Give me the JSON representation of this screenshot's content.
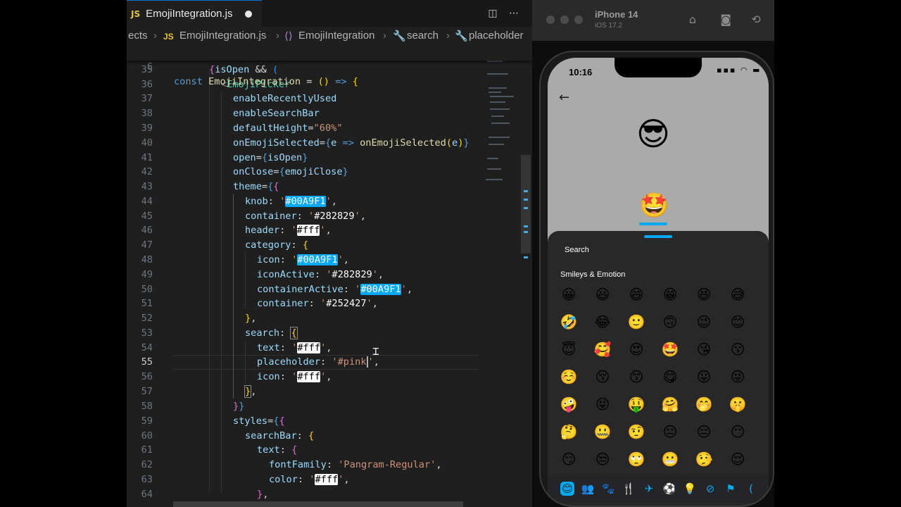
{
  "editor": {
    "tab": {
      "badge": "JS",
      "title": "EmojiIntegration.js"
    },
    "breadcrumb": {
      "part1": "ects",
      "badge": "JS",
      "file": "EmojiIntegration.js",
      "sym1": "EmojiIntegration",
      "sym2": "search",
      "sym3": "placeholder"
    },
    "current_line": 55,
    "lines": [
      {
        "n": 6,
        "text": "const EmojiIntegration = () => {"
      },
      {
        "n": 35,
        "text": "{isOpen && ("
      },
      {
        "n": 36,
        "text": "<EmojiPicker"
      },
      {
        "n": 37,
        "text": "enableRecentlyUsed"
      },
      {
        "n": 38,
        "text": "enableSearchBar"
      },
      {
        "n": 39,
        "text": "defaultHeight=\"60%\""
      },
      {
        "n": 40,
        "text": "onEmojiSelected={e => onEmojiSelected(e)}"
      },
      {
        "n": 41,
        "text": "open={isOpen}"
      },
      {
        "n": 42,
        "text": "onClose={emojiClose}"
      },
      {
        "n": 43,
        "text": "theme={{"
      },
      {
        "n": 44,
        "text": "knob: '#00A9F1',"
      },
      {
        "n": 45,
        "text": "container: '#282829',"
      },
      {
        "n": 46,
        "text": "header: '#fff',"
      },
      {
        "n": 47,
        "text": "category: {"
      },
      {
        "n": 48,
        "text": "icon: '#00A9F1',"
      },
      {
        "n": 49,
        "text": "iconActive: '#282829',"
      },
      {
        "n": 50,
        "text": "containerActive: '#00A9F1',"
      },
      {
        "n": 51,
        "text": "container: '#252427',"
      },
      {
        "n": 52,
        "text": "},"
      },
      {
        "n": 53,
        "text": "search: {"
      },
      {
        "n": 54,
        "text": "text: '#fff',"
      },
      {
        "n": 55,
        "text": "placeholder: '#pink',"
      },
      {
        "n": 56,
        "text": "icon: '#fff',"
      },
      {
        "n": 57,
        "text": "},"
      },
      {
        "n": 58,
        "text": "}}"
      },
      {
        "n": 59,
        "text": "styles={{"
      },
      {
        "n": 60,
        "text": "searchBar: {"
      },
      {
        "n": 61,
        "text": "text: {"
      },
      {
        "n": 62,
        "text": "fontFamily: 'Pangram-Regular',"
      },
      {
        "n": 63,
        "text": "color: '#fff',"
      },
      {
        "n": 64,
        "text": "},"
      }
    ]
  },
  "simulator": {
    "device_name": "iPhone 14",
    "os_version": "iOS 17.2",
    "status_time": "10:16",
    "big_emoji": "😎",
    "small_emoji": "🤩",
    "search_placeholder": "Search",
    "section_title": "Smileys & Emotion",
    "emoji_rows": [
      [
        "😀",
        "😃",
        "😄",
        "😁",
        "😆",
        "😅"
      ],
      [
        "🤣",
        "😂",
        "🙂",
        "🙃",
        "😉",
        "😊"
      ],
      [
        "😇",
        "🥰",
        "😍",
        "🤩",
        "😘",
        "😗"
      ],
      [
        "☺️",
        "😚",
        "😙",
        "😋",
        "😛",
        "😜"
      ],
      [
        "🤪",
        "😝",
        "🤑",
        "🤗",
        "🤭",
        "🤫"
      ],
      [
        "🤔",
        "🤐",
        "🤨",
        "😐",
        "😑",
        "😶"
      ],
      [
        "😏",
        "😒",
        "🙄",
        "😬",
        "🤥",
        "😌"
      ]
    ],
    "category_icons": [
      "😊",
      "👥",
      "🐾",
      "🍴",
      "✈",
      "⚽",
      "💡",
      "⊘",
      "⚑",
      "("
    ],
    "colors": {
      "knob": "#00A9F1",
      "container": "#282829",
      "header": "#fff",
      "category_icon": "#00A9F1",
      "category_icon_active": "#282829",
      "category_container_active": "#00A9F1",
      "category_container": "#252427",
      "search_text": "#fff",
      "search_placeholder": "#pink",
      "search_icon": "#fff"
    }
  }
}
